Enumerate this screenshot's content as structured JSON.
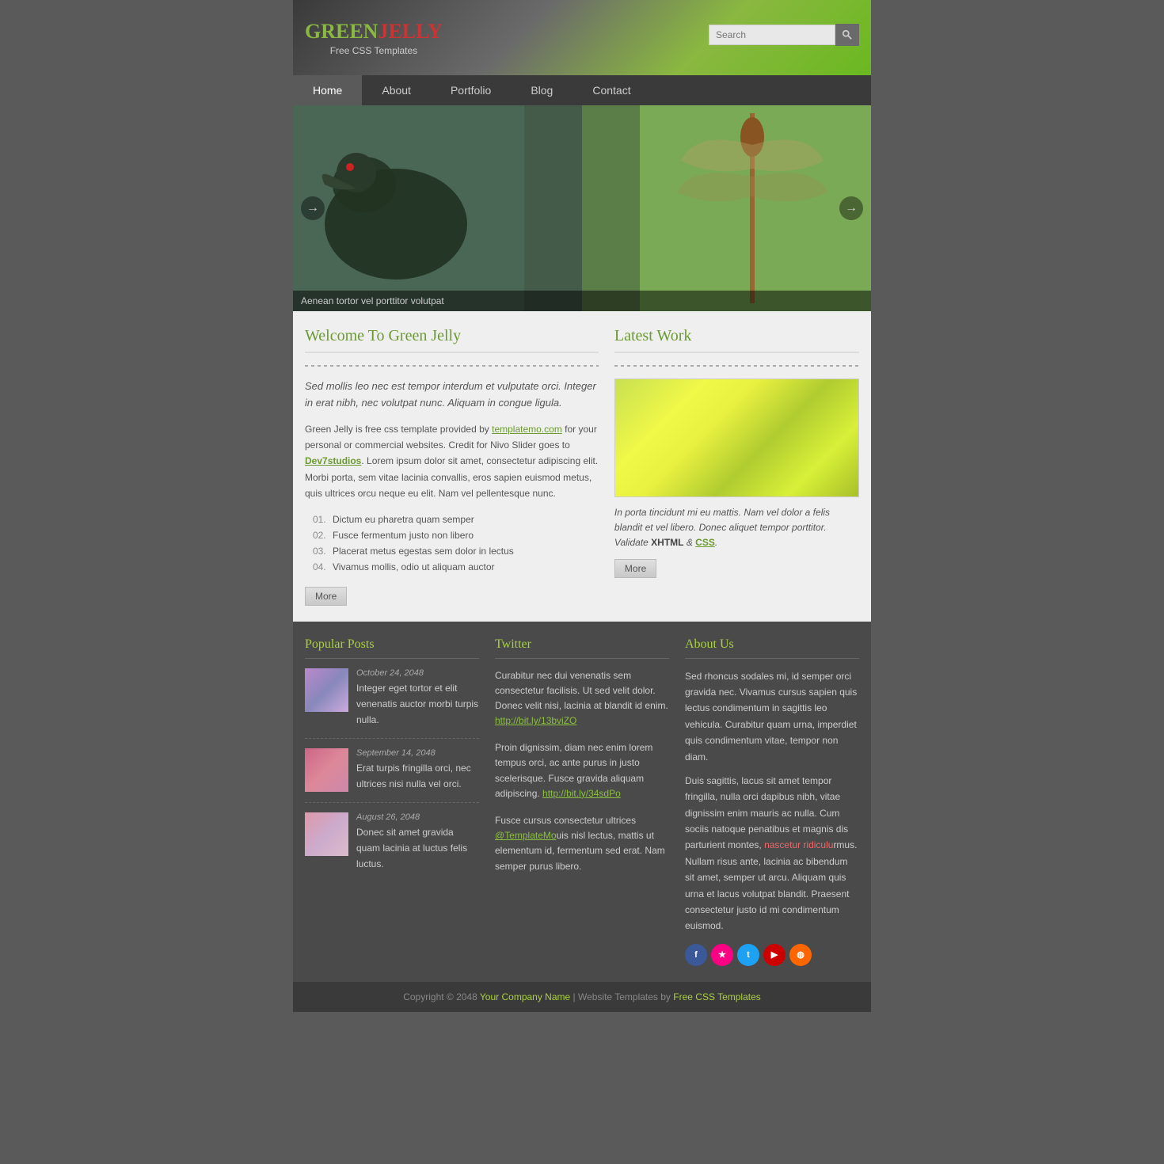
{
  "header": {
    "logo_green": "GREEN",
    "logo_jelly": "JELLY",
    "tagline": "Free CSS Templates",
    "search_placeholder": "Search"
  },
  "nav": {
    "items": [
      {
        "label": "Home",
        "active": true
      },
      {
        "label": "About",
        "active": false
      },
      {
        "label": "Portfolio",
        "active": false
      },
      {
        "label": "Blog",
        "active": false
      },
      {
        "label": "Contact",
        "active": false
      }
    ]
  },
  "slider": {
    "caption": "Aenean tortor vel porttitor volutpat"
  },
  "welcome": {
    "title": "Welcome To Green Jelly",
    "intro": "Sed mollis leo nec est tempor interdum et vulputate orci. Integer in erat nibh, nec volutpat nunc. Aliquam in congue ligula.",
    "body1": "Green Jelly is free css template provided by ",
    "body_link": "templatemo.com",
    "body2": " for your personal or commercial websites. Credit for Nivo Slider goes to ",
    "body_link2": "Dev7studios",
    "body3": ". Lorem ipsum dolor sit amet, consectetur adipiscing elit. Morbi porta, sem vitae lacinia convallis, eros sapien euismod metus, quis ultrices orcu neque eu elit. Nam vel pellentesque nunc.",
    "list": [
      "Dictum eu pharetra quam semper",
      "Fusce fermentum justo non libero",
      "Placerat metus egestas sem dolor in lectus",
      "Vivamus mollis, odio ut aliquam auctor"
    ],
    "more_btn": "More"
  },
  "latest_work": {
    "title": "Latest Work",
    "desc": "In porta tincidunt mi eu mattis. Nam vel dolor a felis blandit et vel libero. Donec aliquet tempor porttitor. Validate ",
    "desc_xhtml": "XHTML",
    "desc_amp": " & ",
    "desc_css": "CSS",
    "desc2": ".",
    "more_btn": "More"
  },
  "popular_posts": {
    "title": "Popular Posts",
    "posts": [
      {
        "date": "October 24, 2048",
        "text": "Integer eget tortor et elit venenatis auctor morbi turpis nulla.",
        "thumb": "thumb1"
      },
      {
        "date": "September 14, 2048",
        "text": "Erat turpis fringilla orci, nec ultrices nisi nulla vel orci.",
        "thumb": "thumb2"
      },
      {
        "date": "August 26, 2048",
        "text": "Donec sit amet gravida quam lacinia at luctus felis luctus.",
        "thumb": "thumb3"
      }
    ]
  },
  "twitter": {
    "title": "Twitter",
    "tweets": [
      {
        "text": "Curabitur nec dui venenatis sem consectetur facilisis. Ut sed velit dolor. Donec velit nisi, lacinia at blandit id enim. ",
        "link": "http://bit.ly/13bviZO"
      },
      {
        "text": "Proin dignissim, diam nec enim lorem tempus orci, ac ante purus in justo scelerisque. Fusce gravida aliquam adipiscing. ",
        "link": "http://bit.ly/34sdPo"
      },
      {
        "text": "Fusce cursus consectetur ultrices ",
        "handle": "@TemplateMo",
        "text2": "uis nisl lectus, mattis ut elementum id, fermentum sed erat. Nam semper purus libero."
      }
    ]
  },
  "about_us": {
    "title": "About Us",
    "para1": "Sed rhoncus sodales mi, id semper orci gravida nec. Vivamus cursus sapien quis lectus condimentum in sagittis leo vehicula. Curabitur quam urna, imperdiet quis condimentum vitae, tempor non diam.",
    "para2": "Duis sagittis, lacus sit amet tempor fringilla, nulla orci dapibus nibh, vitae dignissim enim mauris ac nulla. Cum sociis natoque penatibus et magnis dis parturient montes, ",
    "link": "nascetur ridiculu",
    "para2b": "rmus. Nullam risus ante, lacinia ac bibendum sit amet, semper ut arcu. Aliquam quis urna et lacus volutpat blandit. Praesent consectetur justo id mi condimentum euismod.",
    "social": {
      "facebook": "f",
      "flickr": "★",
      "twitter": "t",
      "youtube": "▶",
      "rss": "◉"
    }
  },
  "footer": {
    "copyright": "Copyright © 2048 ",
    "company": "Your Company Name",
    "sep": " | Website Templates by ",
    "templates_link": "Free CSS Templates"
  }
}
